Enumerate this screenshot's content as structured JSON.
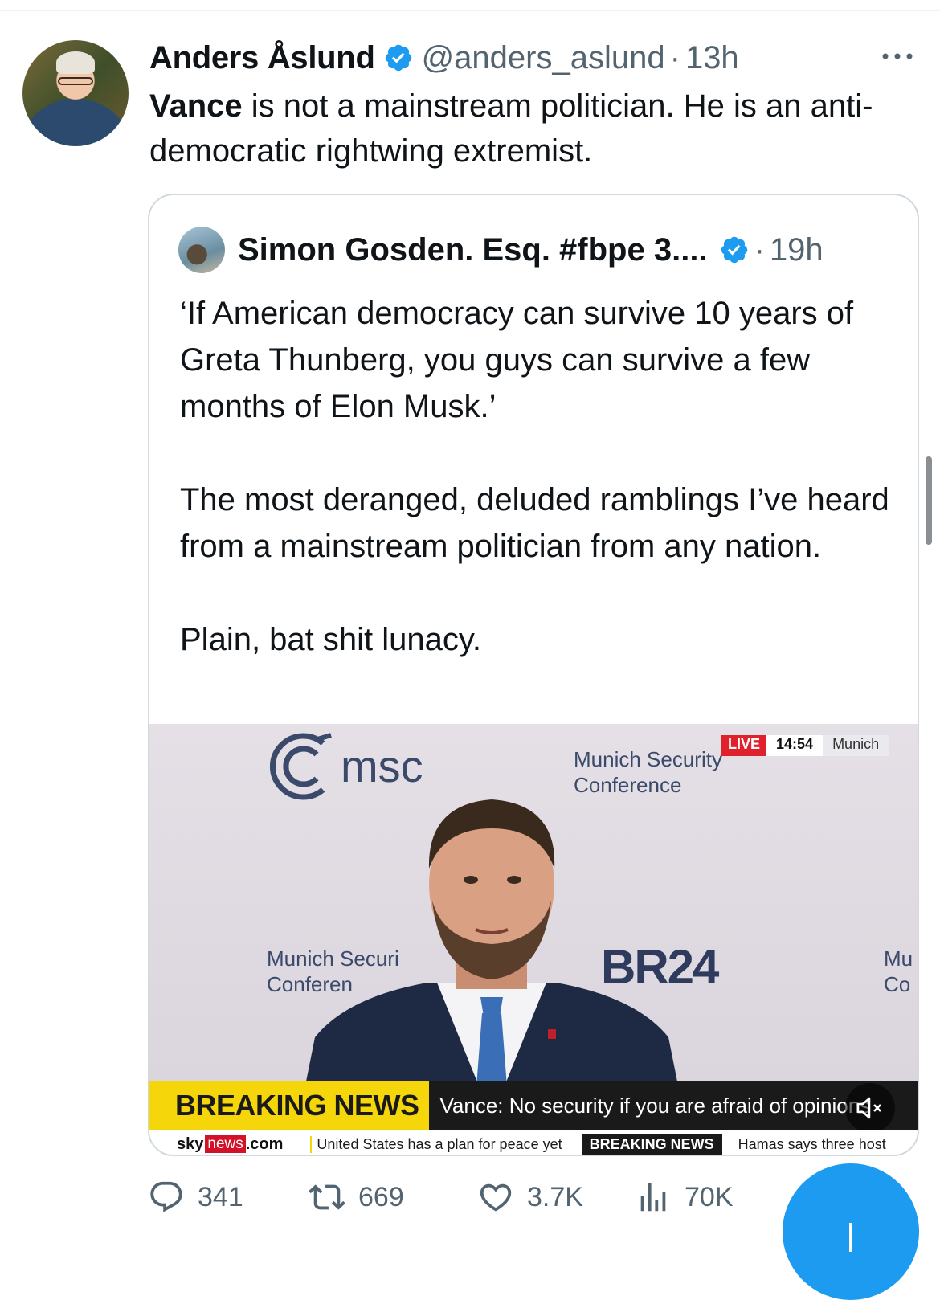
{
  "tweet": {
    "author": {
      "display_name": "Anders Åslund",
      "handle": "@anders_aslund",
      "time": "13h",
      "verified": true
    },
    "text_bold": "Vance",
    "text_rest": " is not a mainstream politician. He is an anti-democratic rightwing extremist."
  },
  "quote": {
    "author": {
      "display_name": "Simon Gosden. Esq. #fbpe 3....",
      "time": "19h",
      "verified": true
    },
    "text": "‘If American democracy can survive 10 years of Greta Thunberg, you guys can survive a few months of Elon Musk.’\n\nThe most deranged, deluded ramblings I’ve heard from a mainstream politician from any nation.\n\nPlain, bat shit lunacy.",
    "media": {
      "logo_text": "msc",
      "conference_line1": "Munich Security",
      "conference_line2": "Conference",
      "conference_left_line1": "Munich Securi",
      "conference_left_line2": "Conferen",
      "conference_right_line1": "Mu",
      "conference_right_line2": "Co",
      "br24": "BR24",
      "live_label": "LIVE",
      "live_time": "14:54",
      "live_location": "Munich",
      "breaking_label": "BREAKING NEWS",
      "headline": "Vance: No security if you are afraid of opinions",
      "sky_logo": "sky",
      "sky_news": "news",
      "sky_com": ".com",
      "ticker_1": "United States has a plan for peace yet",
      "ticker_2": "BREAKING NEWS",
      "ticker_3": "Hamas says three host"
    }
  },
  "actions": {
    "replies": "341",
    "reposts": "669",
    "likes": "3.7K",
    "views": "70K"
  },
  "colors": {
    "accent": "#1d9bf0",
    "muted": "#536471",
    "border": "#cfd9de",
    "breaking_yellow": "#f5d60b",
    "live_red": "#e0202a"
  }
}
